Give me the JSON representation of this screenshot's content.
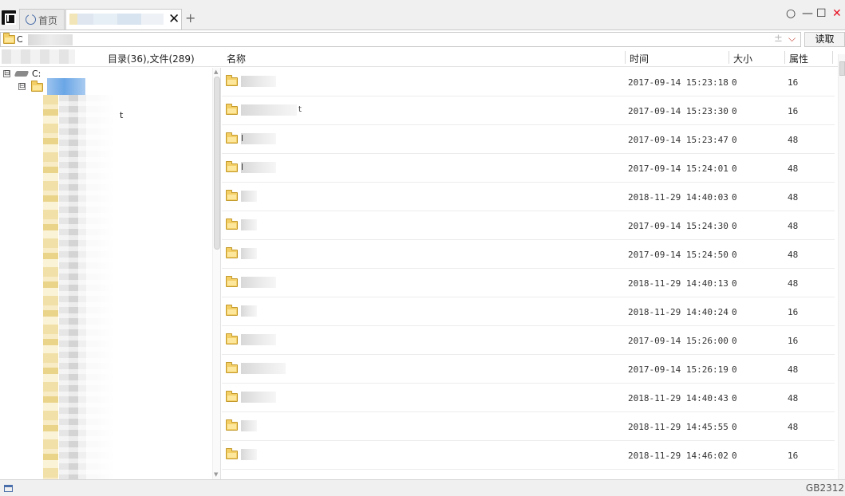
{
  "tabs": {
    "home_label": "首页",
    "new_tab": "+",
    "close": "✕"
  },
  "window_controls": {
    "settings": "○",
    "minimize": "—",
    "maximize": "☐",
    "close": "✕",
    "close_color": "#e81123"
  },
  "address": {
    "path_prefix": "C",
    "plus_minus": "±",
    "dropdown": "⌵",
    "read_button": "读取"
  },
  "tree": {
    "drive_label": "C:",
    "collapse_symbol": "⊟",
    "visible_fragment": "t"
  },
  "list_header": {
    "summary": "目录(36),文件(289)",
    "columns": [
      "名称",
      "时间",
      "大小",
      "属性"
    ]
  },
  "rows": [
    {
      "name_lead": "",
      "name_tail": "",
      "time": "2017-09-14 15:23:18",
      "size": "0",
      "attr": "16"
    },
    {
      "name_lead": "",
      "name_tail": "t",
      "time": "2017-09-14 15:23:30",
      "size": "0",
      "attr": "16"
    },
    {
      "name_lead": "l",
      "name_tail": "",
      "time": "2017-09-14 15:23:47",
      "size": "0",
      "attr": "48"
    },
    {
      "name_lead": "l",
      "name_tail": "",
      "time": "2017-09-14 15:24:01",
      "size": "0",
      "attr": "48"
    },
    {
      "name_lead": "",
      "name_tail": "",
      "time": "2018-11-29 14:40:03",
      "size": "0",
      "attr": "48"
    },
    {
      "name_lead": "",
      "name_tail": "",
      "time": "2017-09-14 15:24:30",
      "size": "0",
      "attr": "48"
    },
    {
      "name_lead": "",
      "name_tail": "",
      "time": "2017-09-14 15:24:50",
      "size": "0",
      "attr": "48"
    },
    {
      "name_lead": "",
      "name_tail": "",
      "time": "2018-11-29 14:40:13",
      "size": "0",
      "attr": "48"
    },
    {
      "name_lead": "",
      "name_tail": "",
      "time": "2018-11-29 14:40:24",
      "size": "0",
      "attr": "16"
    },
    {
      "name_lead": "",
      "name_tail": "",
      "time": "2017-09-14 15:26:00",
      "size": "0",
      "attr": "16"
    },
    {
      "name_lead": "",
      "name_tail": "",
      "time": "2017-09-14 15:26:19",
      "size": "0",
      "attr": "48"
    },
    {
      "name_lead": "",
      "name_tail": "",
      "time": "2018-11-29 14:40:43",
      "size": "0",
      "attr": "48"
    },
    {
      "name_lead": "",
      "name_tail": "",
      "time": "2018-11-29 14:45:55",
      "size": "0",
      "attr": "48"
    },
    {
      "name_lead": "",
      "name_tail": "",
      "time": "2018-11-29 14:46:02",
      "size": "0",
      "attr": "16"
    }
  ],
  "status": {
    "encoding": "GB2312"
  },
  "colors": {
    "selection": "#6aa6e6",
    "folder": "#f3cf66"
  }
}
